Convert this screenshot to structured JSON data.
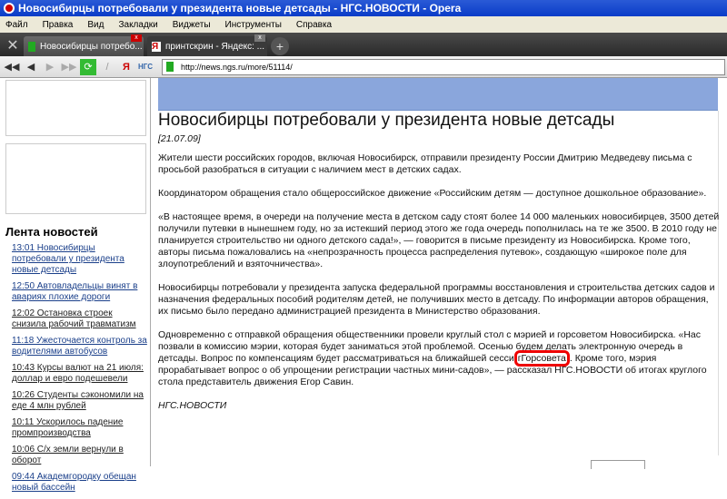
{
  "window": {
    "title": "Новосибирцы потребовали у президента новые детсады - НГС.НОВОСТИ - Opera"
  },
  "menu": [
    "Файл",
    "Правка",
    "Вид",
    "Закладки",
    "Виджеты",
    "Инструменты",
    "Справка"
  ],
  "tabs": [
    {
      "label": "Новосибирцы потребо..."
    },
    {
      "label": "принтскрин - Яндекс: ..."
    }
  ],
  "toolbar": {
    "url": "http://news.ngs.ru/more/51114/",
    "ngs_label": "НГС",
    "yandex_label": "Я"
  },
  "sidebar": {
    "heading": "Лента новостей",
    "items": [
      {
        "text": "13:01 Новосибирцы потребовали у президента новые детсады",
        "visited": false
      },
      {
        "text": "12:50 Автовладельцы винят в авариях плохие дороги",
        "visited": false
      },
      {
        "text": "12:02 Остановка строек снизила рабочий травматизм",
        "visited": true
      },
      {
        "text": "11:18 Ужесточается контроль за водителями автобусов",
        "visited": false
      },
      {
        "text": "10:43 Курсы валют на 21 июля: доллар и евро подешевели",
        "visited": true
      },
      {
        "text": "10:26 Студенты сэкономили на еде 4 млн рублей",
        "visited": true
      },
      {
        "text": "10:11 Ускорилось падение промпроизводства",
        "visited": true
      },
      {
        "text": "10:06 С/х земли вернули в оборот",
        "visited": true
      },
      {
        "text": "09:44 Академгородку обещан новый бассейн",
        "visited": false
      }
    ]
  },
  "article": {
    "title": "Новосибирцы потребовали у президента новые детсады",
    "date": "[21.07.09]",
    "p1": " Жители шести российских городов, включая Новосибирск, отправили президенту России Дмитрию Медведеву письма с просьбой разобраться в ситуации с наличием мест в детских садах.",
    "p2": "Координатором обращения стало общероссийское движение «Российским детям — доступное дошкольное образование».",
    "p3": "«В настоящее время, в очереди на получение места в детском саду стоят более 14 000 маленьких новосибирцев, 3500 детей получили путевки в нынешнем году, но за истекший период этого же года очередь пополнилась на те же 3500. В 2010 году не планируется строительство ни одного детского сада!», — говорится в письме президенту из Новосибирска. Кроме того, авторы письма пожаловались на «непрозрачность процесса распределения путевок», создающую «широкое поле для злоупотреблений и взяточничества».",
    "p4": "Новосибирцы потребовали у президента запуска федеральной программы восстановления и строительства детских садов и назначения федеральных пособий родителям детей, не получивших место в детсаду. По информации авторов обращения, их письмо было передано администрацией президента в Министерство образования.",
    "p5a": "Одновременно с отправкой обращения общественники провели круглый стол с мэрией и горсоветом Новосибирска. «Нас позвали в комиссию мэрии, которая будет заниматься этой проблемой. Осенью будем делать электронную очередь в детсады. Вопрос по компенсациям будет рассматриваться на ближайшей сесси",
    "p5hl": "гГорсовета",
    "p5b": ". Кроме того, мэрия прорабатывает вопрос о об упрощении регистрации частных мини-садов», — рассказал НГС.НОВОСТИ об итогах круглого стола представитель движения Егор Савин.",
    "source": "НГС.НОВОСТИ"
  },
  "colors": {
    "banner": "#8aa6dc",
    "link": "#1a3f8a",
    "highlight": "#e00000"
  }
}
